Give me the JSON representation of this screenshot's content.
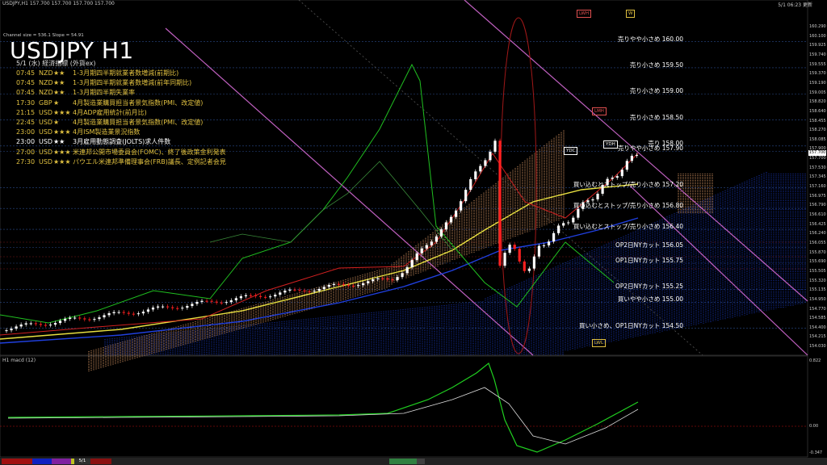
{
  "window": {
    "title": "USDJPY,H1  157.700 157.700 157.700 157.700",
    "clock": "5/1 06:23 更新"
  },
  "channel_info": "Channel size = 536.1 Slope = 54.91",
  "symbol_title": "USDJPY H1",
  "events_header": "5/1 (水) 経済指標 (外貨ex)",
  "events": [
    {
      "time": "07:45",
      "cur": "NZD",
      "stars": "★★",
      "name": "1-3月期四半期就業者数増減(前期比)",
      "color": "#e0c040"
    },
    {
      "time": "07:45",
      "cur": "NZD",
      "stars": "★★",
      "name": "1-3月期四半期就業者数増減(前年同期比)",
      "color": "#e0c040"
    },
    {
      "time": "07:45",
      "cur": "NZD",
      "stars": "★★",
      "name": "1-3月期四半期失業率",
      "color": "#e0c040"
    },
    {
      "time": "17:30",
      "cur": "GBP",
      "stars": "★",
      "name": "4月製造業購買担当者景気指数(PMI、改定値)",
      "color": "#e0c040"
    },
    {
      "time": "21:15",
      "cur": "USD",
      "stars": "★★★",
      "name": "4月ADP雇用統計(前月比)",
      "color": "#e0c040"
    },
    {
      "time": "22:45",
      "cur": "USD",
      "stars": "★",
      "name": "4月製造業購買担当者景気指数(PMI、改定値)",
      "color": "#e0c040"
    },
    {
      "time": "23:00",
      "cur": "USD",
      "stars": "★★★",
      "name": "4月ISM製造業景況指数",
      "color": "#e0c040"
    },
    {
      "time": "23:00",
      "cur": "USD",
      "stars": "★★",
      "name": "3月雇用動態調査(JOLTS)求人件数",
      "color": "#ffffff"
    },
    {
      "time": "27:00",
      "cur": "USD",
      "stars": "★★★",
      "name": "米連邦公開市場委員会(FOMC)、終了後政策金利発表",
      "color": "#e0c040"
    },
    {
      "time": "27:30",
      "cur": "USD",
      "stars": "★★★",
      "name": "パウエル米連邦準備理事会(FRB)議長、定例記者会見",
      "color": "#e0c040"
    }
  ],
  "levels": [
    {
      "label": "売りやや小さめ 160.00",
      "price": 160.0
    },
    {
      "label": "売り小さめ 159.50",
      "price": 159.5
    },
    {
      "label": "売り小さめ 159.00",
      "price": 159.0
    },
    {
      "label": "売り小さめ 158.50",
      "price": 158.5
    },
    {
      "label": "売り 158.00",
      "price": 158.0
    },
    {
      "label": "売りやや小さめ 157.90",
      "price": 157.9
    },
    {
      "label": "買い込むとストップ/売り小さめ 157.20",
      "price": 157.2
    },
    {
      "label": "買い込むとストップ/売り小さめ 156.80",
      "price": 156.8
    },
    {
      "label": "買い込むとストップ/売り小さめ 156.40",
      "price": 156.4
    },
    {
      "label": "OP2日NYカット 156.05",
      "price": 156.05
    },
    {
      "label": "OP1日NYカット 155.75",
      "price": 155.75
    },
    {
      "label": "OP2日NYカット 155.25",
      "price": 155.25
    },
    {
      "label": "買いやや小さめ 155.00",
      "price": 155.0
    },
    {
      "label": "買い小さめ、OP1日NYカット 154.50",
      "price": 154.5
    }
  ],
  "markers": [
    {
      "label": "LWH",
      "color": "#e05050"
    },
    {
      "label": "W",
      "color": "#e0c040"
    },
    {
      "label": "LMH",
      "color": "#e05050"
    },
    {
      "label": "YDC",
      "color": "#ffffff"
    },
    {
      "label": "YDH",
      "color": "#ffffff"
    },
    {
      "label": "LWL",
      "color": "#e0c040"
    }
  ],
  "price_axis": [
    "160.290",
    "160.100",
    "159.925",
    "159.740",
    "159.555",
    "159.370",
    "159.190",
    "159.005",
    "158.820",
    "158.640",
    "158.455",
    "158.270",
    "158.085",
    "157.900",
    "157.700",
    "157.530",
    "157.345",
    "157.160",
    "156.975",
    "156.790",
    "156.610",
    "156.425",
    "156.240",
    "156.055",
    "155.870",
    "155.690",
    "155.505",
    "155.320",
    "155.135",
    "154.950",
    "154.770",
    "154.585",
    "154.400",
    "154.215",
    "154.030"
  ],
  "last_price": "157.700",
  "indicator": {
    "label": "H1 macd (12)",
    "top": "0.822",
    "zero": "0.00",
    "bottom": "-0.347"
  },
  "tabs": [
    "",
    "",
    "",
    "",
    "5/1",
    "",
    "",
    ""
  ]
}
